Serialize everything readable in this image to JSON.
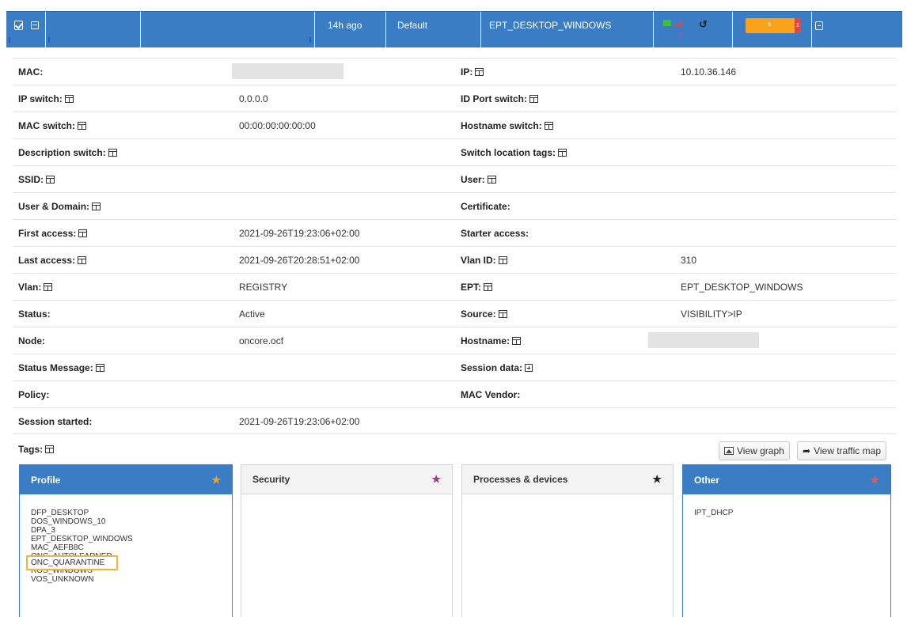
{
  "topbar": {
    "time": "14h ago",
    "group": "Default",
    "ept": "EPT_DESKTOP_WINDOWS",
    "alert_count": "9",
    "alert_red": "1"
  },
  "info": {
    "rows": [
      {
        "l1": "MAC:",
        "v1": "",
        "l2": "IP:",
        "v2": "10.10.36.146"
      },
      {
        "l1": "IP switch:",
        "v1": "0.0.0.0",
        "l2": "ID Port switch:",
        "v2": ""
      },
      {
        "l1": "MAC switch:",
        "v1": "00:00:00:00:00:00",
        "l2": "Hostname switch:",
        "v2": ""
      },
      {
        "l1": "Description switch:",
        "v1": "",
        "l2": "Switch location tags:",
        "v2": ""
      },
      {
        "l1": "SSID:",
        "v1": "",
        "l2": "User:",
        "v2": ""
      },
      {
        "l1": "User & Domain:",
        "v1": "",
        "l2": "Certificate:",
        "v2": ""
      },
      {
        "l1": "First access:",
        "v1": "2021-09-26T19:23:06+02:00",
        "l2": "Starter access:",
        "v2": ""
      },
      {
        "l1": "Last access:",
        "v1": "2021-09-26T20:28:51+02:00",
        "l2": "Vlan ID:",
        "v2": "310"
      },
      {
        "l1": "Vlan:",
        "v1": "REGISTRY",
        "l2": "EPT:",
        "v2": "EPT_DESKTOP_WINDOWS"
      },
      {
        "l1": "Status:",
        "v1": "Active",
        "l2": "Source:",
        "v2": "VISIBILITY>IP"
      },
      {
        "l1": "Node:",
        "v1": "oncore.ocf",
        "l2": "Hostname:",
        "v2": ""
      },
      {
        "l1": "Status Message:",
        "v1": "",
        "l2": "Session data:",
        "v2": ""
      },
      {
        "l1": "Policy:",
        "v1": "",
        "l2": "MAC Vendor:",
        "v2": ""
      },
      {
        "l1": "Session started:",
        "v1": "2021-09-26T19:23:06+02:00",
        "l2": "",
        "v2": ""
      }
    ]
  },
  "tags": {
    "label": "Tags:",
    "view_graph": "View graph",
    "view_traffic_map": "View traffic map"
  },
  "panels": {
    "profile": {
      "title": "Profile",
      "items": [
        "DFP_DESKTOP",
        "DOS_WINDOWS_10",
        "DPA_3",
        "EPT_DESKTOP_WINDOWS",
        "MAC_AEFB8C",
        "ONC_AUTOLEARNED",
        "ONC_QUARANTINE",
        "ROS_WINDOWS",
        "VOS_UNKNOWN"
      ]
    },
    "security": {
      "title": "Security"
    },
    "processes": {
      "title": "Processes & devices"
    },
    "other": {
      "title": "Other",
      "items": [
        "IPT_DHCP"
      ]
    }
  },
  "colors": {
    "accent_blue": "#3b7dc5",
    "highlight": "#f2b43e",
    "star_yellow": "#f9a21a",
    "star_purple": "#9b3a86",
    "star_red": "#e8575a"
  }
}
